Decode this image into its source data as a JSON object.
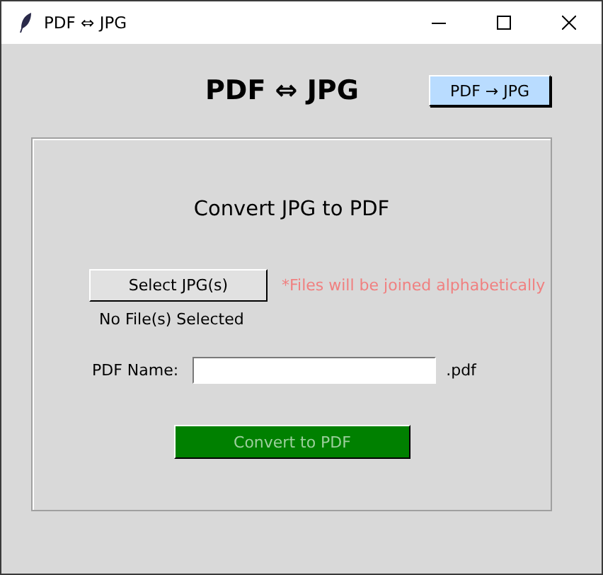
{
  "window": {
    "title": "PDF ⇔ JPG"
  },
  "header": {
    "title": "PDF ⇔ JPG",
    "mode_button": "PDF → JPG"
  },
  "panel": {
    "title": "Convert JPG to PDF",
    "select_button": "Select JPG(s)",
    "hint": "*Files will be joined alphabetically",
    "status": "No File(s) Selected",
    "name_label": "PDF Name:",
    "suffix": ".pdf",
    "convert_button": {
      "label": "Convert to PDF",
      "disabled": true
    }
  }
}
